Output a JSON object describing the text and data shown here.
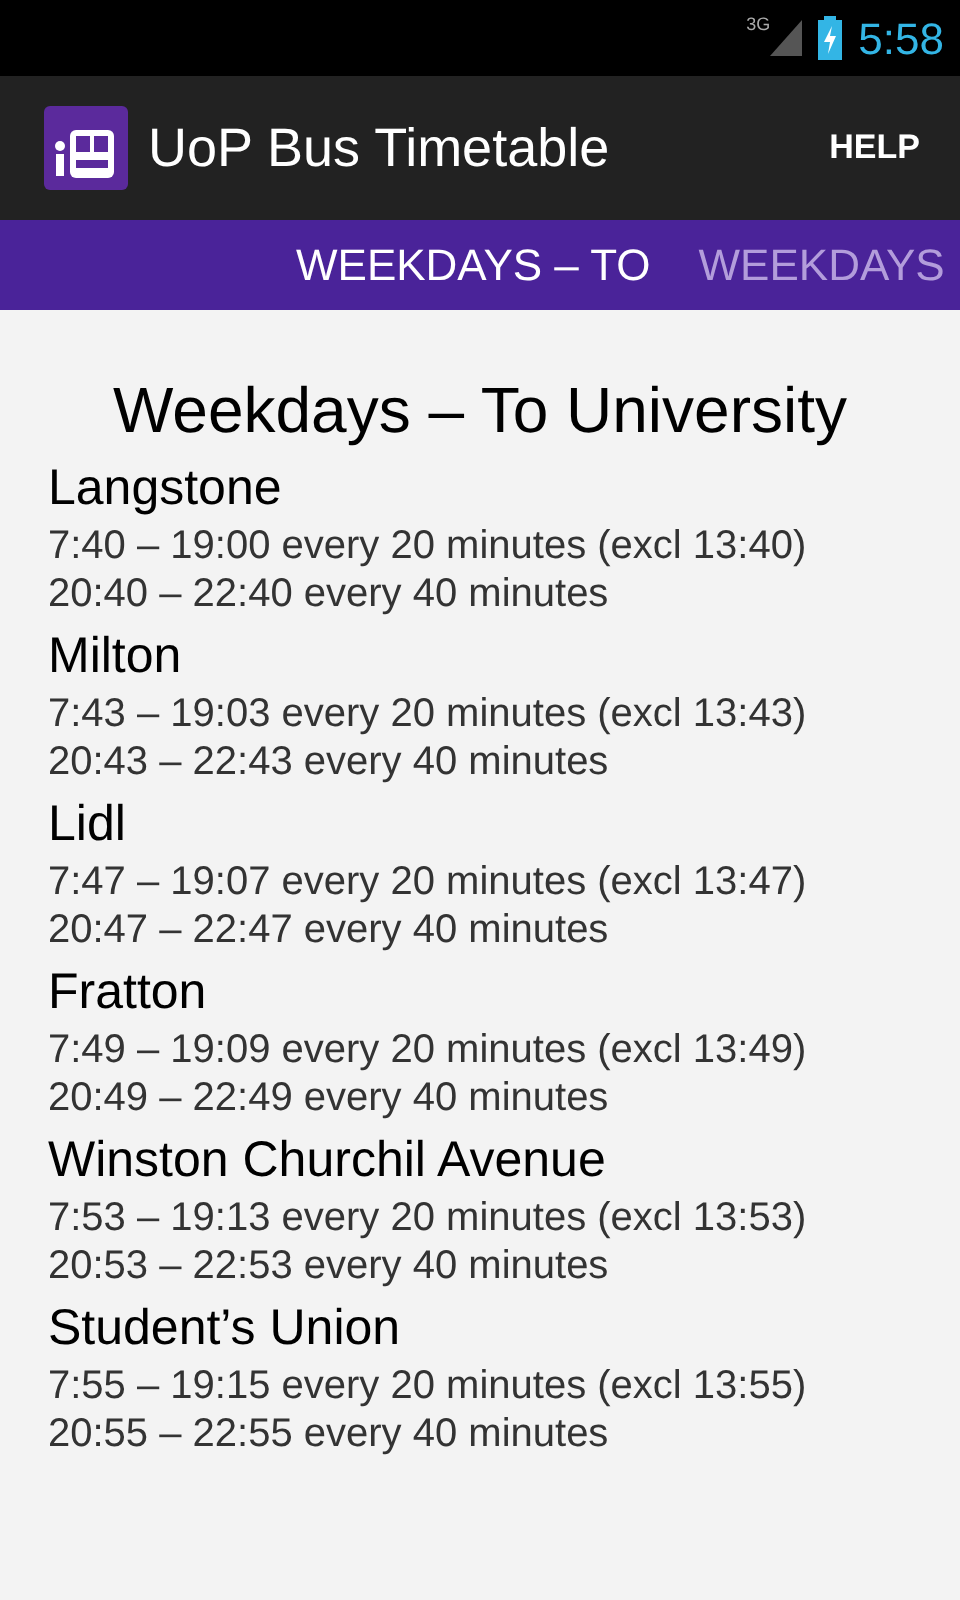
{
  "status_bar": {
    "network": "3G",
    "time": "5:58"
  },
  "action_bar": {
    "title": "UoP Bus Timetable",
    "action": "HELP"
  },
  "tabs": [
    {
      "label": "WEEKDAYS – TO",
      "selected": true
    },
    {
      "label": "WEEKDAYS",
      "selected": false
    }
  ],
  "heading": "Weekdays – To University",
  "stops": [
    {
      "name": "Langstone",
      "times": [
        "7:40 – 19:00 every 20 minutes (excl 13:40)",
        "20:40 – 22:40 every 40 minutes"
      ]
    },
    {
      "name": "Milton",
      "times": [
        "7:43 – 19:03 every 20 minutes (excl 13:43)",
        "20:43 – 22:43 every 40 minutes"
      ]
    },
    {
      "name": "Lidl",
      "times": [
        "7:47 – 19:07 every 20 minutes (excl 13:47)",
        "20:47 – 22:47 every 40 minutes"
      ]
    },
    {
      "name": "Fratton",
      "times": [
        "7:49 – 19:09 every 20 minutes (excl 13:49)",
        "20:49 – 22:49 every 40 minutes"
      ]
    },
    {
      "name": "Winston Churchil Avenue",
      "times": [
        "7:53 – 19:13 every 20 minutes (excl 13:53)",
        "20:53 – 22:53 every 40 minutes"
      ]
    },
    {
      "name": "Student’s Union",
      "times": [
        "7:55 – 19:15 every 20 minutes (excl 13:55)",
        "20:55 – 22:55 every 40 minutes"
      ]
    }
  ]
}
